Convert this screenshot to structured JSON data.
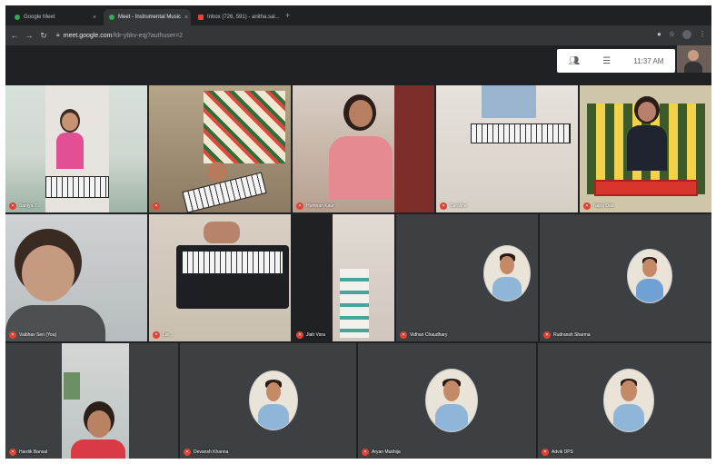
{
  "browser": {
    "tabs": [
      {
        "label": "Google Meet",
        "active": false,
        "favicon_color": "#34a853"
      },
      {
        "label": "Meet - Instrumental Music",
        "active": true,
        "favicon_color": "#34a853"
      },
      {
        "label": "Inbox (726, 591) - anitha.sai...",
        "active": false,
        "favicon_color": "#ea4335"
      }
    ],
    "tab_close_glyph": "×",
    "new_tab_glyph": "+",
    "url_host": "meet.google.com",
    "url_path": "/fdr-ybkv-eqj?authuser=2"
  },
  "meet_bar": {
    "time": "11:37 AM",
    "icons": [
      "people-icon",
      "chat-icon"
    ]
  },
  "participants": [
    {
      "name": "Saniya T..."
    },
    {
      "name": ""
    },
    {
      "name": "Humnan Kaur"
    },
    {
      "name": "Caroline"
    },
    {
      "name": "Naira Das"
    },
    {
      "name": "Vaibhav Sen (You)"
    },
    {
      "name": "Lor..."
    },
    {
      "name": "Jiah Vora"
    },
    {
      "name": "Vidhan Chaudhary"
    },
    {
      "name": "Rudransh Sharma"
    },
    {
      "name": "Hardik Bansal"
    },
    {
      "name": "Devansh Khanna"
    },
    {
      "name": "Aryan Mukhija"
    },
    {
      "name": "Advik DPS"
    }
  ],
  "colors": {
    "background": "#202124",
    "mic_off": "#ea4335"
  }
}
